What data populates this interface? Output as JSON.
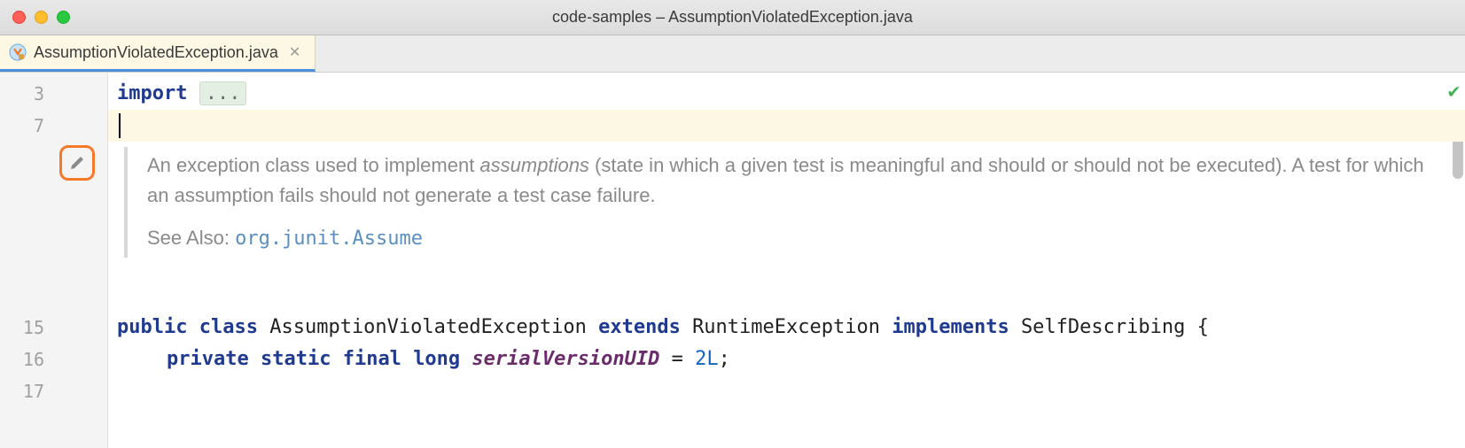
{
  "window": {
    "title": "code-samples – AssumptionViolatedException.java"
  },
  "tab": {
    "filename": "AssumptionViolatedException.java"
  },
  "gutter": {
    "lines": [
      "3",
      "7",
      "",
      "",
      "",
      "",
      "",
      "15",
      "16",
      "17"
    ]
  },
  "code": {
    "import_kw": "import",
    "folded_ellipsis": "...",
    "javadoc": {
      "body_pre": "An exception class used to implement ",
      "body_em": "assumptions",
      "body_post": " (state in which a given test is meaningful and should or should not be executed). A test for which an assumption fails should not generate a test case failure.",
      "see_also_label": "See Also:",
      "see_also_link": "org.junit.Assume"
    },
    "class_decl": {
      "public_kw": "public",
      "class_kw": "class",
      "class_name": "AssumptionViolatedException",
      "extends_kw": "extends",
      "super_name": "RuntimeException",
      "implements_kw": "implements",
      "iface_name": "SelfDescribing",
      "brace": "{"
    },
    "field": {
      "private_kw": "private",
      "static_kw": "static",
      "final_kw": "final",
      "long_kw": "long",
      "name": "serialVersionUID",
      "eq": " = ",
      "value": "2L",
      "semi": ";"
    }
  }
}
